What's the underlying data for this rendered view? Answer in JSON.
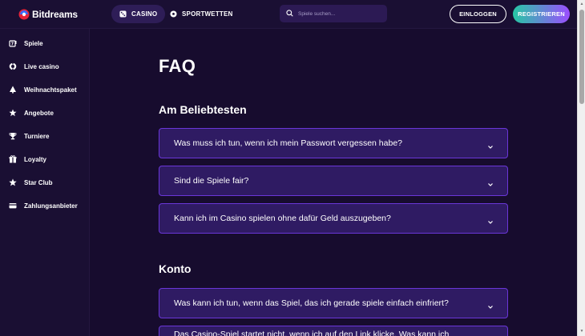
{
  "brand": {
    "name": "Bitdreams"
  },
  "topnav": {
    "casino_label": "CASINO",
    "sport_label": "SPORTWETTEN"
  },
  "search": {
    "placeholder": "Spiele suchen..."
  },
  "auth": {
    "login_label": "EINLOGGEN",
    "register_label": "REGISTRIEREN"
  },
  "sidebar": {
    "items": [
      {
        "label": "Spiele",
        "icon": "slot-icon"
      },
      {
        "label": "Live casino",
        "icon": "chip-icon"
      },
      {
        "label": "Weihnachtspaket",
        "icon": "tree-icon"
      },
      {
        "label": "Angebote",
        "icon": "star-burst-icon"
      },
      {
        "label": "Turniere",
        "icon": "trophy-icon"
      },
      {
        "label": "Loyalty",
        "icon": "gift-icon"
      },
      {
        "label": "Star Club",
        "icon": "star-icon"
      },
      {
        "label": "Zahlungsanbieter",
        "icon": "card-icon"
      }
    ]
  },
  "main": {
    "title": "FAQ",
    "sections": [
      {
        "title": "Am Beliebtesten",
        "questions": [
          "Was muss ich tun, wenn ich mein Passwort vergessen habe?",
          "Sind die Spiele fair?",
          "Kann ich im Casino spielen ohne dafür Geld auszugeben?"
        ]
      },
      {
        "title": "Konto",
        "questions": [
          "Was kann ich tun, wenn das Spiel, das ich gerade spiele einfach einfriert?",
          "Das Casino-Spiel startet nicht, wenn ich auf den Link klicke. Was kann ich"
        ]
      }
    ]
  },
  "colors": {
    "background": "#170c2e",
    "panel": "#1a0f33",
    "accordion_bg": "#2f1b63",
    "accordion_border": "#6a36d8",
    "accent_green": "#27c7a4",
    "accent_purple": "#9b4dff"
  }
}
